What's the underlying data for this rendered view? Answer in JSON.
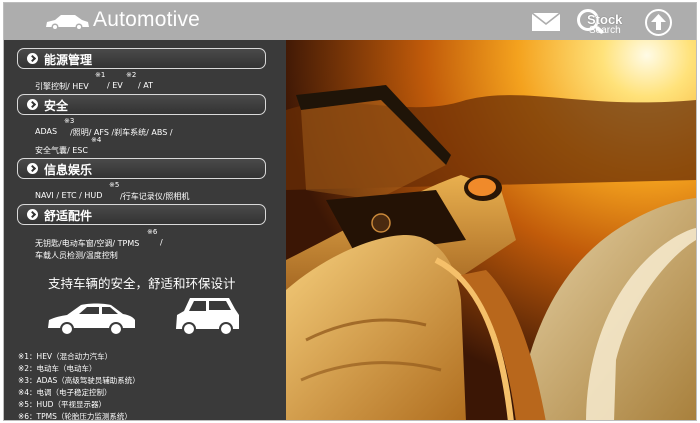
{
  "header": {
    "title": "Automotive",
    "logo_icon": "car-logo-icon",
    "mail_icon": "mail-icon",
    "stock_search": {
      "line1": "Stock",
      "line2": "Search",
      "icon": "search-icon"
    },
    "up_icon": "arrow-up-icon",
    "background": "#adadad"
  },
  "sections": [
    {
      "label": "能源管理",
      "notes": [
        "※1",
        "※2"
      ],
      "lines": [
        "引擎控制/ HEV",
        "/ EV",
        "/ AT"
      ]
    },
    {
      "label": "安全",
      "notes": [
        "※3",
        "※4"
      ],
      "lines": [
        "ADAS",
        "/照明/ AFS /刹车系统/ ABS /",
        "安全气囊/ ESC"
      ]
    },
    {
      "label": "信息娱乐",
      "notes": [
        "※5"
      ],
      "lines": [
        "NAVI / ETC / HUD",
        "/行车记录仪/照相机"
      ]
    },
    {
      "label": "舒适配件",
      "notes": [
        "※6"
      ],
      "lines": [
        "无钥匙/电动车窗/空调/ TPMS",
        "/",
        "车载人员检测/温度控制"
      ]
    }
  ],
  "tagline": "支持车辆的安全，舒适和环保设计",
  "footnotes": [
    "※1：HEV（混合动力汽车）",
    "※2：电动车（电动车）",
    "※3：ADAS（高级驾驶员辅助系统）",
    "※4：电调（电子稳定控制）",
    "※5：HUD（平视显示器）",
    "※6：TPMS（轮胎压力监测系统）"
  ]
}
